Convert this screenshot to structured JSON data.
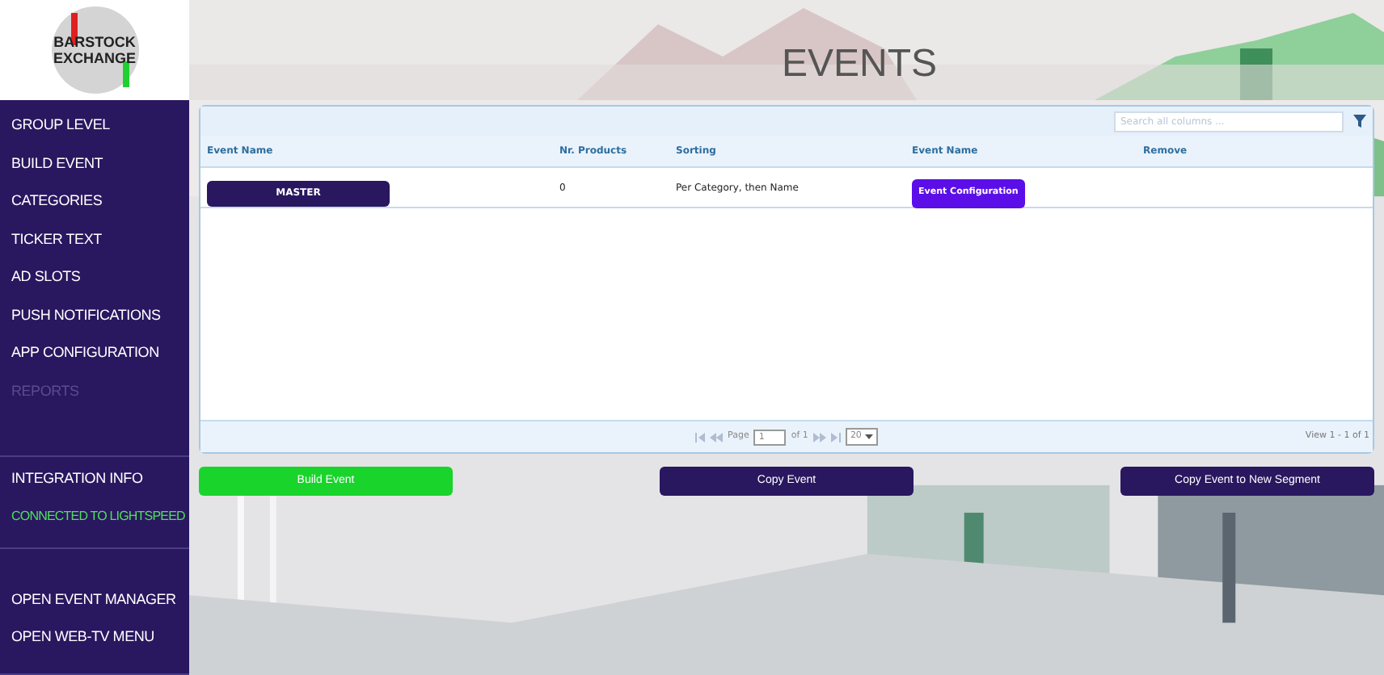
{
  "logo": {
    "line_1": "BARSTOCK",
    "line_2": "EXCHANGE"
  },
  "page_title": "EVENTS",
  "sidebar": {
    "groups": [
      {
        "items": [
          {
            "label": "GROUP LEVEL",
            "disabled": false
          },
          {
            "label": "BUILD EVENT",
            "disabled": false
          },
          {
            "label": "CATEGORIES",
            "disabled": false
          },
          {
            "label": "TICKER TEXT",
            "disabled": false
          },
          {
            "label": "AD SLOTS",
            "disabled": false
          },
          {
            "label": "PUSH NOTIFICATIONS",
            "disabled": false
          },
          {
            "label": "APP CONFIGURATION",
            "disabled": false
          },
          {
            "label": "REPORTS",
            "disabled": true
          }
        ]
      },
      {
        "items": [
          {
            "label": "INTEGRATION INFO",
            "disabled": false
          }
        ],
        "status": "CONNECTED TO LIGHTSPEED"
      },
      {
        "items": [
          {
            "label": "OPEN EVENT MANAGER",
            "disabled": false
          },
          {
            "label": "OPEN WEB-TV MENU",
            "disabled": false
          }
        ]
      }
    ]
  },
  "table": {
    "search": {
      "placeholder": "Search all columns ..."
    },
    "columns": [
      "Event Name",
      "Nr. Products",
      "Sorting",
      "Event Name",
      "Remove"
    ],
    "rows": [
      {
        "name": "MASTER",
        "products": "0",
        "sorting": "Per Category, then Name",
        "action": "Event Configuration"
      }
    ],
    "pager": {
      "page_label": "Page",
      "page": "1",
      "of": "of 1",
      "page_size": "20",
      "view": "View 1 - 1 of 1"
    }
  },
  "buttons": [
    {
      "label": "Build Event",
      "kind": "primary"
    },
    {
      "label": "Copy Event",
      "kind": "secondary"
    },
    {
      "label": "Copy Event to New Segment",
      "kind": "secondary"
    }
  ]
}
